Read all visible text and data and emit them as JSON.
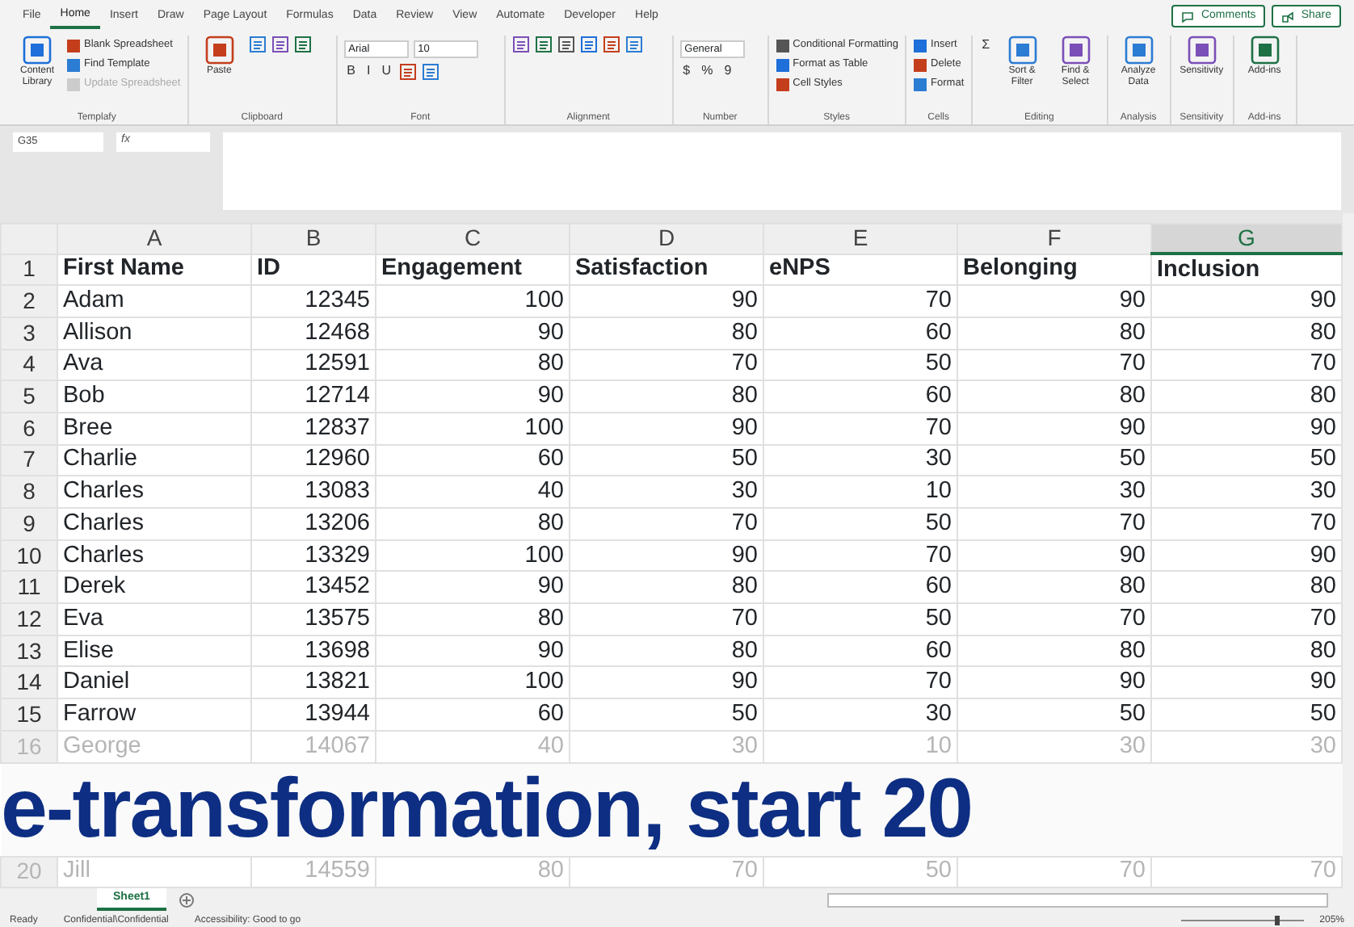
{
  "ribbon_tabs": [
    {
      "label": "File",
      "selected": false
    },
    {
      "label": "Home",
      "selected": true
    },
    {
      "label": "Insert",
      "selected": false
    },
    {
      "label": "Draw",
      "selected": false
    },
    {
      "label": "Page Layout",
      "selected": false
    },
    {
      "label": "Formulas",
      "selected": false
    },
    {
      "label": "Data",
      "selected": false
    },
    {
      "label": "Review",
      "selected": false
    },
    {
      "label": "View",
      "selected": false
    },
    {
      "label": "Automate",
      "selected": false
    },
    {
      "label": "Developer",
      "selected": false
    },
    {
      "label": "Help",
      "selected": false
    }
  ],
  "header_buttons": [
    "Comments",
    "Share"
  ],
  "ribbon_groups": [
    {
      "label": "Templafy",
      "items": [
        {
          "kind": "large",
          "label": "Content Library"
        },
        {
          "kind": "small",
          "label": "Blank Spreadsheet",
          "disabled": false
        },
        {
          "kind": "small",
          "label": "Find Template",
          "disabled": false
        },
        {
          "kind": "small",
          "label": "Update Spreadsheet",
          "disabled": true
        }
      ]
    },
    {
      "label": "Clipboard",
      "items": [
        {
          "kind": "large",
          "label": "Paste"
        },
        {
          "kind": "icon"
        },
        {
          "kind": "icon"
        },
        {
          "kind": "icon"
        }
      ]
    },
    {
      "label": "Font",
      "items": [
        {
          "kind": "field",
          "label": "Arial"
        },
        {
          "kind": "field",
          "label": "10"
        },
        {
          "kind": "char",
          "label": "B"
        },
        {
          "kind": "char",
          "label": "I"
        },
        {
          "kind": "char",
          "label": "U"
        },
        {
          "kind": "icon"
        },
        {
          "kind": "icon"
        }
      ]
    },
    {
      "label": "Alignment",
      "items": [
        {
          "kind": "icon"
        },
        {
          "kind": "icon"
        },
        {
          "kind": "icon"
        },
        {
          "kind": "icon"
        },
        {
          "kind": "icon"
        },
        {
          "kind": "icon"
        }
      ]
    },
    {
      "label": "Number",
      "items": [
        {
          "kind": "field",
          "label": "General"
        },
        {
          "kind": "char",
          "label": "$"
        },
        {
          "kind": "char",
          "label": "%"
        },
        {
          "kind": "char",
          "label": "9"
        }
      ]
    },
    {
      "label": "Styles",
      "items": [
        {
          "kind": "small",
          "label": "Conditional Formatting",
          "disabled": false
        },
        {
          "kind": "small",
          "label": "Format as Table",
          "disabled": false
        },
        {
          "kind": "small",
          "label": "Cell Styles",
          "disabled": false
        }
      ]
    },
    {
      "label": "Cells",
      "items": [
        {
          "kind": "small",
          "label": "Insert",
          "disabled": false
        },
        {
          "kind": "small",
          "label": "Delete",
          "disabled": false
        },
        {
          "kind": "small",
          "label": "Format",
          "disabled": false
        }
      ]
    },
    {
      "label": "Editing",
      "items": [
        {
          "kind": "char",
          "label": "Σ"
        },
        {
          "kind": "large",
          "label": "Sort & Filter"
        },
        {
          "kind": "large",
          "label": "Find & Select"
        }
      ]
    },
    {
      "label": "Analysis",
      "items": [
        {
          "kind": "large",
          "label": "Analyze Data"
        }
      ]
    },
    {
      "label": "Sensitivity",
      "items": [
        {
          "kind": "large",
          "label": "Sensitivity"
        }
      ]
    },
    {
      "label": "Add-ins",
      "items": [
        {
          "kind": "large",
          "label": "Add-ins"
        }
      ]
    }
  ],
  "formula_bar": {
    "name_box": "G35",
    "fx": "fx"
  },
  "columns": [
    {
      "label": "A",
      "selected": false
    },
    {
      "label": "B",
      "selected": false
    },
    {
      "label": "C",
      "selected": false
    },
    {
      "label": "D",
      "selected": false
    },
    {
      "label": "E",
      "selected": false
    },
    {
      "label": "F",
      "selected": false
    },
    {
      "label": "G",
      "selected": true
    }
  ],
  "rows": [
    {
      "number": "1",
      "faded": false,
      "cells": [
        "First Name",
        "ID",
        "Engagement",
        "Satisfaction",
        "eNPS",
        "Belonging",
        "Inclusion"
      ]
    },
    {
      "number": "2",
      "faded": false,
      "cells": [
        "Adam",
        "12345",
        "100",
        "90",
        "70",
        "90",
        "90"
      ]
    },
    {
      "number": "3",
      "faded": false,
      "cells": [
        "Allison",
        "12468",
        "90",
        "80",
        "60",
        "80",
        "80"
      ]
    },
    {
      "number": "4",
      "faded": false,
      "cells": [
        "Ava",
        "12591",
        "80",
        "70",
        "50",
        "70",
        "70"
      ]
    },
    {
      "number": "5",
      "faded": false,
      "cells": [
        "Bob",
        "12714",
        "90",
        "80",
        "60",
        "80",
        "80"
      ]
    },
    {
      "number": "6",
      "faded": false,
      "cells": [
        "Bree",
        "12837",
        "100",
        "90",
        "70",
        "90",
        "90"
      ]
    },
    {
      "number": "7",
      "faded": false,
      "cells": [
        "Charlie",
        "12960",
        "60",
        "50",
        "30",
        "50",
        "50"
      ]
    },
    {
      "number": "8",
      "faded": false,
      "cells": [
        "Charles",
        "13083",
        "40",
        "30",
        "10",
        "30",
        "30"
      ]
    },
    {
      "number": "9",
      "faded": false,
      "cells": [
        "Charles",
        "13206",
        "80",
        "70",
        "50",
        "70",
        "70"
      ]
    },
    {
      "number": "10",
      "faded": false,
      "cells": [
        "Charles",
        "13329",
        "100",
        "90",
        "70",
        "90",
        "90"
      ]
    },
    {
      "number": "11",
      "faded": false,
      "cells": [
        "Derek",
        "13452",
        "90",
        "80",
        "60",
        "80",
        "80"
      ]
    },
    {
      "number": "12",
      "faded": false,
      "cells": [
        "Eva",
        "13575",
        "80",
        "70",
        "50",
        "70",
        "70"
      ]
    },
    {
      "number": "13",
      "faded": false,
      "cells": [
        "Elise",
        "13698",
        "90",
        "80",
        "60",
        "80",
        "80"
      ]
    },
    {
      "number": "14",
      "faded": false,
      "cells": [
        "Daniel",
        "13821",
        "100",
        "90",
        "70",
        "90",
        "90"
      ]
    },
    {
      "number": "15",
      "faded": false,
      "cells": [
        "Farrow",
        "13944",
        "60",
        "50",
        "30",
        "50",
        "50"
      ]
    },
    {
      "number": "16",
      "faded": true,
      "cells": [
        "George",
        "14067",
        "40",
        "30",
        "10",
        "30",
        "30"
      ]
    },
    {
      "number": "20",
      "faded": true,
      "cells": [
        "Jill",
        "14559",
        "80",
        "70",
        "50",
        "70",
        "70"
      ]
    }
  ],
  "caption": "e-transformation, start 20",
  "sheet_tabs": [
    {
      "label": "Sheet1",
      "selected": true
    }
  ],
  "status_bar": {
    "ready": "Ready",
    "label": "Confidential\\Confidential",
    "accessibility": "Accessibility: Good to go",
    "zoom": "205%"
  }
}
